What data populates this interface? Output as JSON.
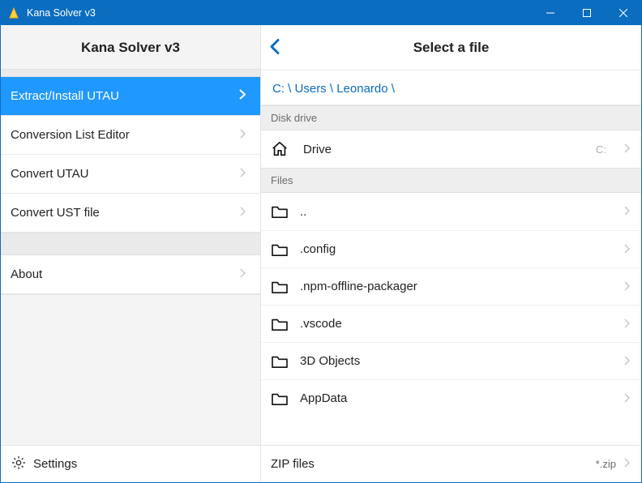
{
  "window": {
    "title": "Kana Solver v3"
  },
  "sidebar": {
    "title": "Kana Solver v3",
    "items": [
      {
        "label": "Extract/Install UTAU",
        "active": true
      },
      {
        "label": "Conversion List Editor",
        "active": false
      },
      {
        "label": "Convert UTAU",
        "active": false
      },
      {
        "label": "Convert UST file",
        "active": false
      }
    ],
    "about": {
      "label": "About"
    },
    "settings": {
      "label": "Settings"
    }
  },
  "main": {
    "title": "Select a file",
    "breadcrumb": [
      "C:",
      "Users",
      "Leonardo"
    ],
    "sections": {
      "drives": {
        "header": "Disk drive",
        "items": [
          {
            "label": "Drive",
            "suffix": "C:"
          }
        ]
      },
      "files": {
        "header": "Files",
        "items": [
          {
            "label": ".."
          },
          {
            "label": ".config"
          },
          {
            "label": ".npm-offline-packager"
          },
          {
            "label": ".vscode"
          },
          {
            "label": "3D Objects"
          },
          {
            "label": "AppData"
          }
        ]
      }
    },
    "footer": {
      "label": "ZIP files",
      "pattern": "*.zip"
    }
  }
}
